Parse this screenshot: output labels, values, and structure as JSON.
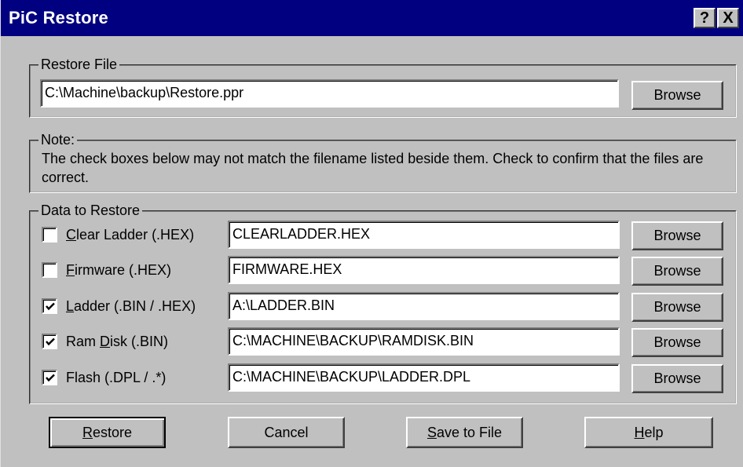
{
  "window": {
    "title": "PiC Restore",
    "help_glyph": "?",
    "close_glyph": "X"
  },
  "restore_file": {
    "legend": "Restore File",
    "path": "C:\\Machine\\backup\\Restore.ppr",
    "browse_label": "Browse"
  },
  "note": {
    "legend": "Note:",
    "text": "The check boxes below may not match the filename listed beside them.  Check to confirm that the files are correct."
  },
  "data_to_restore": {
    "legend": "Data to Restore",
    "rows": [
      {
        "label_pre": "",
        "label_key": "C",
        "label_post": "lear Ladder (.HEX)",
        "checked": false,
        "file": "CLEARLADDER.HEX",
        "browse_label": "Browse"
      },
      {
        "label_pre": "",
        "label_key": "F",
        "label_post": "irmware (.HEX)",
        "checked": false,
        "file": "FIRMWARE.HEX",
        "browse_label": "Browse"
      },
      {
        "label_pre": "",
        "label_key": "L",
        "label_post": "adder (.BIN / .HEX)",
        "checked": true,
        "file": "A:\\LADDER.BIN",
        "browse_label": "Browse"
      },
      {
        "label_pre": "Ram ",
        "label_key": "D",
        "label_post": "isk (.BIN)",
        "checked": true,
        "file": "C:\\MACHINE\\BACKUP\\RAMDISK.BIN",
        "browse_label": "Browse"
      },
      {
        "label_pre": "Flash (.DPL / .*)",
        "label_key": "",
        "label_post": "",
        "checked": true,
        "file": "C:\\MACHINE\\BACKUP\\LADDER.DPL",
        "browse_label": "Browse"
      }
    ]
  },
  "buttons": {
    "restore_key": "R",
    "restore_rest": "estore",
    "cancel": "Cancel",
    "save_key": "S",
    "save_rest": "ave to File",
    "help_key": "H",
    "help_rest": "elp"
  }
}
